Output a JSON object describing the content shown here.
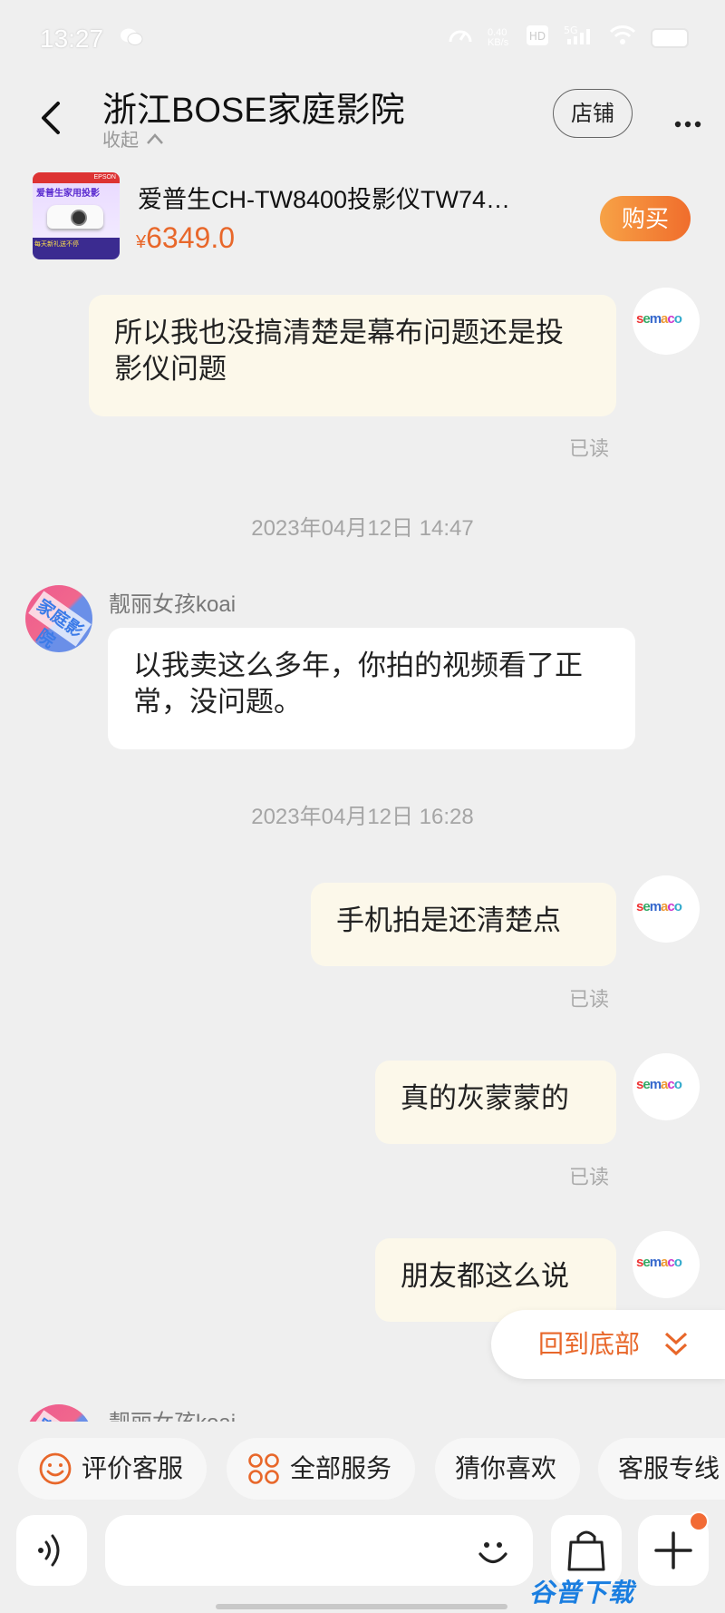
{
  "status_bar": {
    "time": "13:27",
    "net_speed": "0.40 KB/s",
    "signal": "5G"
  },
  "header": {
    "title": "浙江BOSE家庭影院",
    "collapse_label": "收起",
    "store_label": "店铺",
    "more_label": "···"
  },
  "product": {
    "name": "爱普生CH-TW8400投影仪TW74…",
    "currency": "¥",
    "price": "6349.0",
    "buy_label": "购买",
    "thumb_brand": "EPSON",
    "thumb_title": "爱普生家用投影",
    "thumb_band": "每天新礼送不停"
  },
  "messages": [
    {
      "from": "me",
      "text": "所以我也没搞清楚是幕布问题还是投影仪问题",
      "status": "已读"
    },
    {
      "type": "time",
      "text": "2023年04月12日 14:47"
    },
    {
      "from": "them",
      "sender": "靓丽女孩koai",
      "text": "以我卖这么多年，你拍的视频看了正常，没问题。"
    },
    {
      "type": "time",
      "text": "2023年04月12日 16:28"
    },
    {
      "from": "me",
      "text": "手机拍是还清楚点",
      "status": "已读"
    },
    {
      "from": "me",
      "text": "真的灰蒙蒙的",
      "status": "已读"
    },
    {
      "from": "me",
      "text": "朋友都这么说"
    },
    {
      "from": "them",
      "sender": "靓丽女孩koai"
    }
  ],
  "avatars": {
    "me_logo": "semaco",
    "them_stamp": "家庭影院"
  },
  "back_to_bottom": "回到底部",
  "chips": [
    "评价客服",
    "全部服务",
    "猜你喜欢",
    "客服专线"
  ],
  "input": {
    "placeholder": ""
  },
  "watermark": "谷普下载",
  "colors": {
    "accent": "#e8672a",
    "buy_gradient_start": "#f7a246",
    "buy_gradient_end": "#f06d2c",
    "my_bubble": "#fcf8ea",
    "their_bubble": "#ffffff",
    "background": "#efefef"
  }
}
